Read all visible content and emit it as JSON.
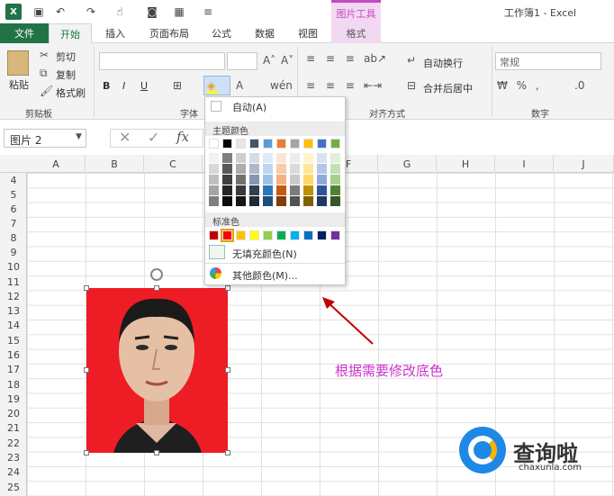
{
  "window": {
    "title": "工作簿1 - Excel",
    "context_tab_group": "图片工具"
  },
  "tabs": [
    {
      "label": "文件"
    },
    {
      "label": "开始"
    },
    {
      "label": "插入"
    },
    {
      "label": "页面布局"
    },
    {
      "label": "公式"
    },
    {
      "label": "数据"
    },
    {
      "label": "视图"
    },
    {
      "label": "格式"
    }
  ],
  "ribbon": {
    "clipboard": {
      "paste": "粘贴",
      "cut": "剪切",
      "copy": "复制",
      "format_painter": "格式刷",
      "group": "剪贴板"
    },
    "font": {
      "group": "字体",
      "bold": "B",
      "italic": "I",
      "underline": "U"
    },
    "alignment": {
      "wrap": "自动换行",
      "merge": "合并后居中",
      "group": "对齐方式"
    },
    "number": {
      "format": "常规",
      "group": "数字"
    }
  },
  "formula_bar": {
    "name_box": "图片 2",
    "fx": "fx"
  },
  "columns": [
    "A",
    "B",
    "C",
    "D",
    "E",
    "F",
    "G",
    "H",
    "I",
    "J"
  ],
  "rows": [
    "4",
    "5",
    "6",
    "7",
    "8",
    "9",
    "10",
    "11",
    "12",
    "13",
    "14",
    "15",
    "16",
    "17",
    "18",
    "19",
    "20",
    "21",
    "22",
    "23",
    "24",
    "25"
  ],
  "fill_menu": {
    "auto": "自动(A)",
    "theme_title": "主题颜色",
    "standard_title": "标准色",
    "no_fill": "无填充颜色(N)",
    "more": "其他颜色(M)...",
    "theme_colors": [
      "#ffffff",
      "#000000",
      "#e7e6e6",
      "#44546a",
      "#5b9bd5",
      "#ed7d31",
      "#a5a5a5",
      "#ffc000",
      "#4472c4",
      "#70ad47"
    ],
    "shade_rows": [
      [
        "#f2f2f2",
        "#7f7f7f",
        "#d0cece",
        "#d6dce4",
        "#deebf6",
        "#fbe5d5",
        "#ededed",
        "#fff2cc",
        "#d9e2f3",
        "#e2efd9"
      ],
      [
        "#d8d8d8",
        "#595959",
        "#aeabab",
        "#adb9ca",
        "#bdd7ee",
        "#f7cbac",
        "#dbdbdb",
        "#fee599",
        "#b4c6e7",
        "#c5e0b3"
      ],
      [
        "#bfbfbf",
        "#3f3f3f",
        "#757070",
        "#8496b0",
        "#9cc3e5",
        "#f4b183",
        "#c9c9c9",
        "#ffd965",
        "#8eaadb",
        "#a8d08d"
      ],
      [
        "#a5a5a5",
        "#262626",
        "#3a3838",
        "#323f4f",
        "#2e75b5",
        "#c55a11",
        "#7b7b7b",
        "#bf9000",
        "#2f5496",
        "#538135"
      ],
      [
        "#7f7f7f",
        "#0c0c0c",
        "#171616",
        "#222a35",
        "#1e4e79",
        "#833c0b",
        "#525252",
        "#7f6000",
        "#1f3864",
        "#375623"
      ]
    ],
    "standard_colors": [
      "#c00000",
      "#ff0000",
      "#ffc000",
      "#ffff00",
      "#92d050",
      "#00b050",
      "#00b0f0",
      "#0070c0",
      "#002060",
      "#7030a0"
    ]
  },
  "annotation": "根据需要修改底色",
  "watermark": {
    "name": "查询啦",
    "url": "chaxunla.com"
  }
}
